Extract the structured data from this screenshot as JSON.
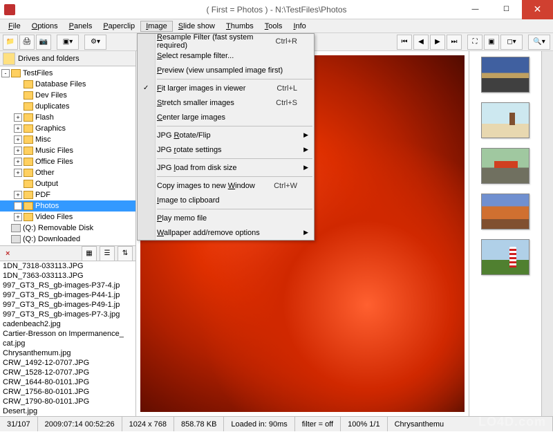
{
  "title": "( First = Photos )  -  N:\\TestFiles\\Photos",
  "menu": {
    "items": [
      "File",
      "Options",
      "Panels",
      "Paperclip",
      "Image",
      "Slide show",
      "Thumbs",
      "Tools",
      "Info"
    ],
    "active": 4
  },
  "drives_header": "Drives and folders",
  "tree": {
    "root": "TestFiles",
    "children": [
      "Database Files",
      "Dev Files",
      "duplicates",
      "Flash",
      "Graphics",
      "Misc",
      "Music Files",
      "Office Files",
      "Other",
      "Output",
      "PDF",
      "Photos",
      "Video Files"
    ],
    "drives": [
      "(Q:)  Removable Disk",
      "(Q:)  Downloaded"
    ],
    "selected": "Photos"
  },
  "files": [
    "1DN_7318-033113.JPG",
    "1DN_7363-033113.JPG",
    "997_GT3_RS_gb-images-P37-4.jp",
    "997_GT3_RS_gb-images-P44-1.jp",
    "997_GT3_RS_gb-images-P49-1.jp",
    "997_GT3_RS_gb-images-P7-3.jpg",
    "cadenbeach2.jpg",
    "Cartier-Bresson on Impermanence_",
    "cat.jpg",
    "Chrysanthemum.jpg",
    "CRW_1492-12-0707.JPG",
    "CRW_1528-12-0707.JPG",
    "CRW_1644-80-0101.JPG",
    "CRW_1756-80-0101.JPG",
    "CRW_1790-80-0101.JPG",
    "Desert.jpg"
  ],
  "dropdown": [
    {
      "type": "item",
      "label": "Resample Filter (fast system required)",
      "shortcut": "Ctrl+R",
      "u": 0
    },
    {
      "type": "item",
      "label": "Select resample filter...",
      "u": 0
    },
    {
      "type": "item",
      "label": "Preview (view unsampled image first)",
      "u": 0
    },
    {
      "type": "sep"
    },
    {
      "type": "item",
      "label": "Fit larger images in viewer",
      "shortcut": "Ctrl+L",
      "u": 0,
      "checked": true
    },
    {
      "type": "item",
      "label": "Stretch smaller images",
      "shortcut": "Ctrl+S",
      "u": 0
    },
    {
      "type": "item",
      "label": "Center large images",
      "u": 0
    },
    {
      "type": "sep"
    },
    {
      "type": "item",
      "label": "JPG Rotate/Flip",
      "u": 4,
      "sub": true
    },
    {
      "type": "item",
      "label": "JPG rotate settings",
      "u": 4,
      "sub": true
    },
    {
      "type": "sep"
    },
    {
      "type": "item",
      "label": "JPG load from disk size",
      "u": 4,
      "sub": true
    },
    {
      "type": "sep"
    },
    {
      "type": "item",
      "label": "Copy images to new Window",
      "shortcut": "Ctrl+W",
      "u": 19
    },
    {
      "type": "item",
      "label": "Image to clipboard",
      "u": 0
    },
    {
      "type": "sep"
    },
    {
      "type": "item",
      "label": "Play memo file",
      "u": 0
    },
    {
      "type": "item",
      "label": "Wallpaper add/remove options",
      "u": 0,
      "sub": true
    }
  ],
  "status": {
    "count": "31/107",
    "date": "2009:07:14 00:52:26",
    "dims": "1024 x 768",
    "size": "858.78 KB",
    "load": "Loaded in: 90ms",
    "filter": "filter = off",
    "zoom": "100% 1/1",
    "name": "Chrysanthemu"
  },
  "watermark": "LO4D.com"
}
